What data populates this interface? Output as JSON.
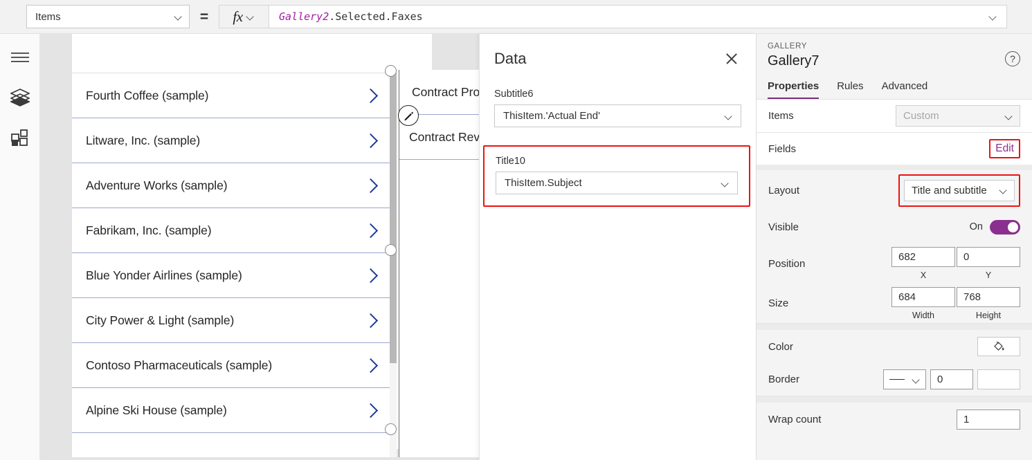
{
  "formula_bar": {
    "property_label": "Items",
    "equals": "=",
    "fx_label": "fx",
    "formula_identifier": "Gallery2",
    "formula_rest": ".Selected.Faxes"
  },
  "rail": {
    "items": [
      {
        "icon": "hamburger-menu-icon"
      },
      {
        "icon": "layers-tree-icon"
      },
      {
        "icon": "insert-grid-icon"
      }
    ]
  },
  "canvas": {
    "gallery_left": {
      "items": [
        {
          "title": "Fourth Coffee (sample)"
        },
        {
          "title": "Litware, Inc. (sample)"
        },
        {
          "title": "Adventure Works (sample)"
        },
        {
          "title": "Fabrikam, Inc. (sample)"
        },
        {
          "title": "Blue Yonder Airlines (sample)"
        },
        {
          "title": "City Power & Light (sample)"
        },
        {
          "title": "Contoso Pharmaceuticals (sample)"
        },
        {
          "title": "Alpine Ski House (sample)"
        }
      ]
    },
    "gallery_right": {
      "items": [
        {
          "title": "Contract Pro"
        },
        {
          "title": "Contract Rev"
        }
      ]
    }
  },
  "data_panel": {
    "title": "Data",
    "close_label": "✕",
    "fields": [
      {
        "label": "Subtitle6",
        "value": "ThisItem.'Actual End'",
        "highlighted": false
      },
      {
        "label": "Title10",
        "value": "ThisItem.Subject",
        "highlighted": true
      }
    ]
  },
  "properties_panel": {
    "kind": "GALLERY",
    "name": "Gallery7",
    "help_label": "?",
    "tabs": [
      {
        "label": "Properties",
        "active": true
      },
      {
        "label": "Rules",
        "active": false
      },
      {
        "label": "Advanced",
        "active": false
      }
    ],
    "items_row": {
      "label": "Items",
      "value": "Custom"
    },
    "fields_row": {
      "label": "Fields",
      "action": "Edit"
    },
    "layout_row": {
      "label": "Layout",
      "value": "Title and subtitle"
    },
    "visible_row": {
      "label": "Visible",
      "state": "On"
    },
    "position_row": {
      "label": "Position",
      "x_value": "682",
      "x_caption": "X",
      "y_value": "0",
      "y_caption": "Y"
    },
    "size_row": {
      "label": "Size",
      "width_value": "684",
      "width_caption": "Width",
      "height_value": "768",
      "height_caption": "Height"
    },
    "color_row": {
      "label": "Color"
    },
    "border_row": {
      "label": "Border",
      "thickness": "0",
      "swatch_color": "#001b6b"
    },
    "wrap_row": {
      "label": "Wrap count",
      "value": "1"
    }
  },
  "colors": {
    "accent_purple": "#8b2f8f",
    "highlight_red": "#ee1111",
    "chevron_blue": "#1f3a93",
    "border_navy": "#001b6b"
  }
}
